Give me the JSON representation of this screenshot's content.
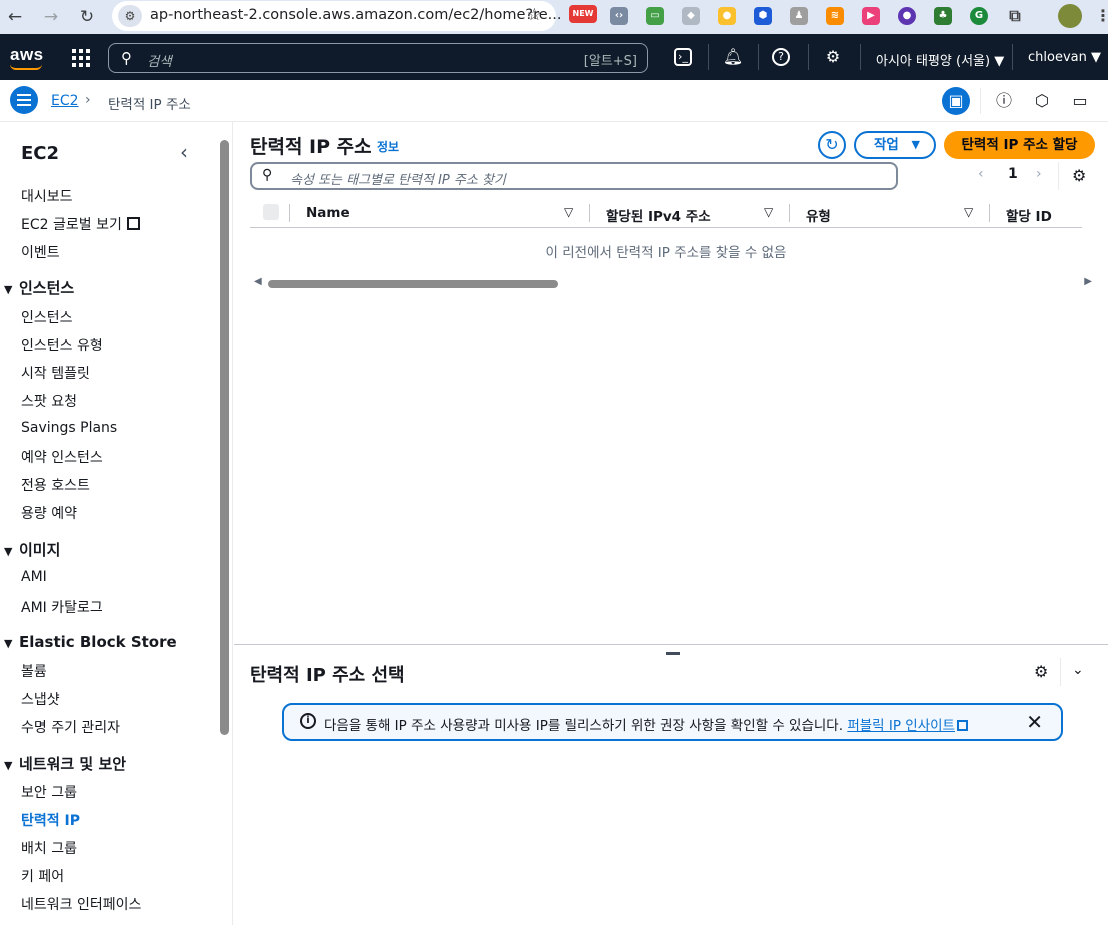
{
  "browser": {
    "url": "ap-northeast-2.console.aws.amazon.com/ec2/home?re...",
    "new_badge": "NEW"
  },
  "topbar": {
    "logo": "aws",
    "search_placeholder": "검색",
    "search_shortcut": "[알트+S]",
    "region": "아시아 태평양 (서울) ▼",
    "user": "chloevan ▼"
  },
  "breadcrumb": {
    "root": "EC2",
    "current": "탄력적 IP 주소"
  },
  "sidebar": {
    "title": "EC2",
    "top_items": [
      "대시보드",
      "EC2 글로벌 보기",
      "이벤트"
    ],
    "sections": [
      {
        "label": "인스턴스",
        "items": [
          "인스턴스",
          "인스턴스 유형",
          "시작 템플릿",
          "스팟 요청",
          "Savings Plans",
          "예약 인스턴스",
          "전용 호스트",
          "용량 예약"
        ]
      },
      {
        "label": "이미지",
        "items": [
          "AMI",
          "AMI 카탈로그"
        ]
      },
      {
        "label": "Elastic Block Store",
        "items": [
          "볼륨",
          "스냅샷",
          "수명 주기 관리자"
        ]
      },
      {
        "label": "네트워크 및 보안",
        "items": [
          "보안 그룹",
          "탄력적 IP",
          "배치 그룹",
          "키 페어",
          "네트워크 인터페이스"
        ]
      }
    ],
    "active_item": "탄력적 IP"
  },
  "main": {
    "title": "탄력적 IP 주소",
    "info": "정보",
    "action_button": "작업",
    "allocate_button": "탄력적 IP 주소 할당",
    "filter_placeholder": "속성 또는 태그별로 탄력적 IP 주소 찾기",
    "page": "1",
    "columns": [
      "Name",
      "할당된 IPv4 주소",
      "유형",
      "할당 ID"
    ],
    "empty_message": "이 리전에서 탄력적 IP 주소를 찾을 수 없음"
  },
  "lower": {
    "title": "탄력적 IP 주소 선택",
    "alert_text": "다음을 통해 IP 주소 사용량과 미사용 IP를 릴리스하기 위한 권장 사항을 확인할 수 있습니다.",
    "alert_link": "퍼블릭 IP 인사이트"
  },
  "colors": {
    "accent": "#0972d3",
    "primary_button": "#ff9900",
    "topbar": "#0f1b2a"
  }
}
